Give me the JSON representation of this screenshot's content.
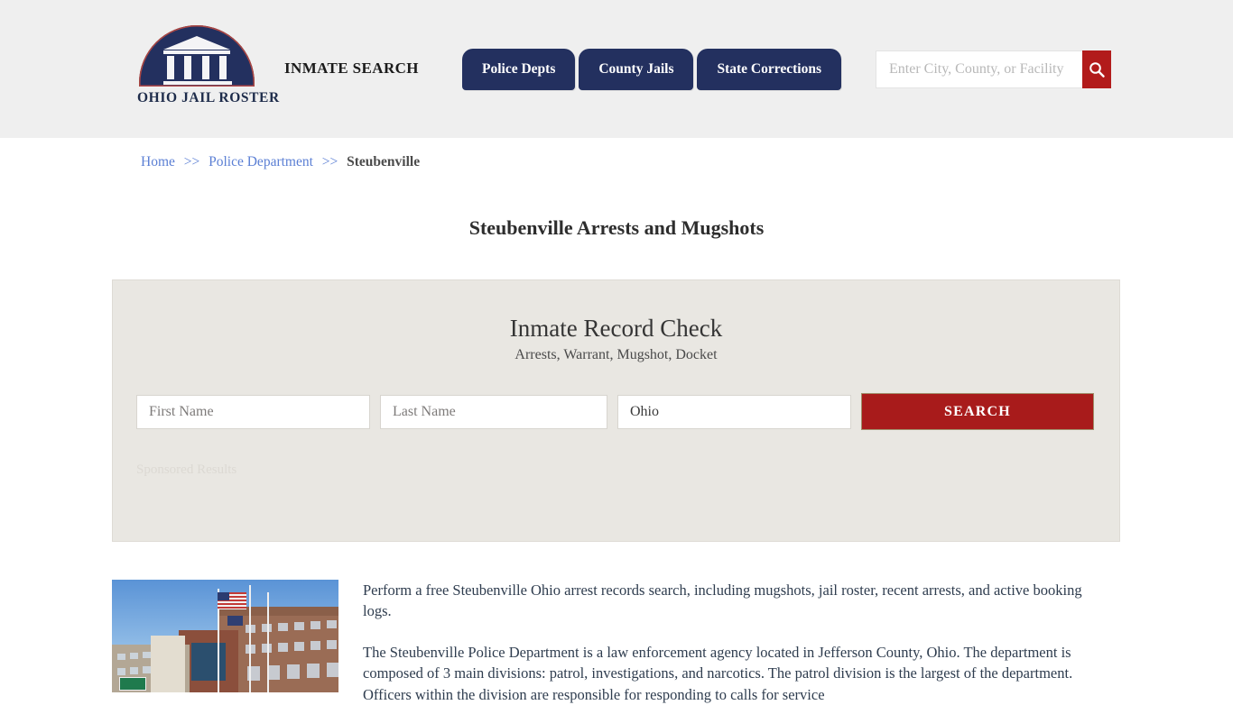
{
  "header": {
    "logo_text": "OHIO JAIL ROSTER",
    "tagline": "INMATE SEARCH",
    "nav": [
      {
        "label": "Police Depts"
      },
      {
        "label": "County Jails"
      },
      {
        "label": "State Corrections"
      }
    ],
    "search": {
      "placeholder": "Enter City, County, or Facility",
      "value": "",
      "button_icon": "search-icon"
    }
  },
  "breadcrumb": {
    "home": "Home",
    "separator": ">>",
    "section": "Police Department",
    "current": "Steubenville"
  },
  "page": {
    "title": "Steubenville Arrests and Mugshots"
  },
  "record_card": {
    "title": "Inmate Record Check",
    "subtitle": "Arrests, Warrant, Mugshot, Docket",
    "first_name_placeholder": "First Name",
    "first_name_value": "",
    "last_name_placeholder": "Last Name",
    "last_name_value": "",
    "state_selected": "Ohio",
    "state_options": [
      "Ohio"
    ],
    "search_button": "SEARCH",
    "sponsored_label": "Sponsored Results"
  },
  "content": {
    "image_alt": "steubenville-police-department-building",
    "paragraphs": [
      "Perform a free Steubenville Ohio arrest records search, including mugshots, jail roster, recent arrests, and active booking logs.",
      "The Steubenville Police Department is a law enforcement agency located in Jefferson County, Ohio. The department is composed of 3 main divisions: patrol, investigations, and narcotics. The patrol division is the largest of the department. Officers within the division are responsible for responding to calls for service"
    ]
  },
  "colors": {
    "brand_navy": "#23305f",
    "accent_red": "#b21b1b",
    "button_red": "#a81b1b",
    "header_bg": "#efefef",
    "card_bg": "#e9e7e2",
    "link_blue": "#5b7fd4"
  }
}
